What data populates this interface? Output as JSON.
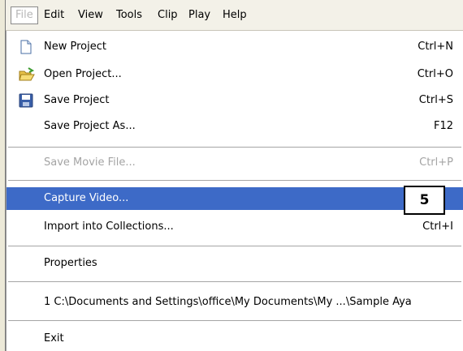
{
  "menubar": {
    "items": [
      "File",
      "Edit",
      "View",
      "Tools",
      "Clip",
      "Play",
      "Help"
    ]
  },
  "file_menu": {
    "new_project": {
      "label": "New Project",
      "shortcut": "Ctrl+N"
    },
    "open_project": {
      "label": "Open Project...",
      "shortcut": "Ctrl+O"
    },
    "save_project": {
      "label": "Save Project",
      "shortcut": "Ctrl+S"
    },
    "save_project_as": {
      "label": "Save Project As...",
      "shortcut": "F12"
    },
    "save_movie_file": {
      "label": "Save Movie File...",
      "shortcut": "Ctrl+P"
    },
    "capture_video": {
      "label": "Capture Video..."
    },
    "import_collections": {
      "label": "Import into Collections...",
      "shortcut": "Ctrl+I"
    },
    "properties": {
      "label": "Properties"
    },
    "recent_file": {
      "label": "1 C:\\Documents and Settings\\office\\My Documents\\My ...\\Sample Aya"
    },
    "exit": {
      "label": "Exit"
    }
  },
  "callout": {
    "label": "5"
  },
  "colors": {
    "highlight": "#3d6ac7",
    "disabled_text": "#a4a4a4",
    "menubar_bg": "#f3f1e8"
  },
  "icons": {
    "new_project": "document-icon",
    "open_project": "folder-open-icon",
    "save_project": "floppy-disk-icon"
  }
}
